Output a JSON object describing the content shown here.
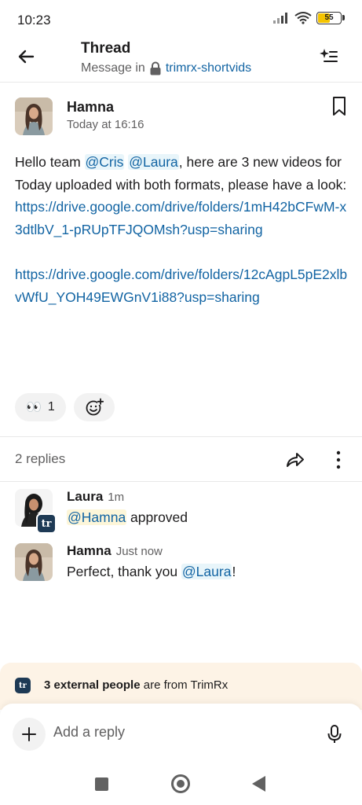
{
  "status": {
    "time": "10:23",
    "battery": "55",
    "battery_level": 0.55
  },
  "header": {
    "title": "Thread",
    "subtitle_prefix": "Message in",
    "channel": "trimrx-shortvids",
    "icons": {
      "back": "arrow-left-icon",
      "lock": "lock-icon",
      "ai": "sparkle-list-icon"
    }
  },
  "post": {
    "author": "Hamna",
    "timestamp": "Today at 16:16",
    "body": {
      "t1": "Hello team ",
      "m1": "@Cris",
      "m2": "@Laura",
      "t2": ", here are 3 new videos for Today uploaded with both formats, please have a look:",
      "link1": "https://drive.google.com/drive/folders/1mH42bCFwM-x3dtlbV_1-pRUpTFJQOMsh?usp=sharing",
      "link2": "https://drive.google.com/drive/folders/12cAgpL5pE2xlbvWfU_YOH49EWGnV1i88?usp=sharing"
    },
    "reactions": [
      {
        "emoji": "👀",
        "count": "1"
      }
    ]
  },
  "thread": {
    "replies_count": "2 replies",
    "replies": [
      {
        "author": "Laura",
        "time": "1m",
        "mention": "@Hamna",
        "text": " approved",
        "badge": "tr"
      },
      {
        "author": "Hamna",
        "time": "Just now",
        "text_before": "Perfect, thank you ",
        "mention": "@Laura",
        "text_after": "!"
      }
    ]
  },
  "external": {
    "bold": "3 external people",
    "rest": " are from TrimRx",
    "icon_label": "tr"
  },
  "composer": {
    "placeholder": "Add a reply"
  },
  "colors": {
    "link": "#1264a3",
    "mention_bg": "#e8f5fa",
    "banner_bg": "#fdf3e6",
    "org_badge": "#1e3a55"
  }
}
